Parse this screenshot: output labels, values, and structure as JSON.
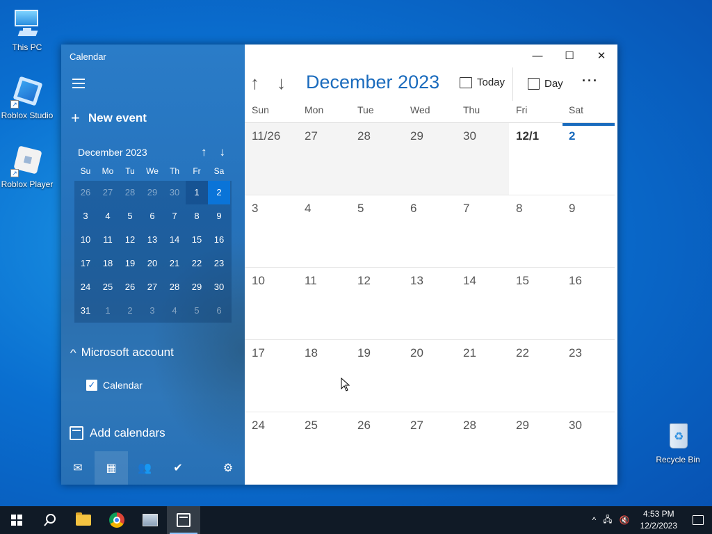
{
  "desktop": {
    "icons": [
      {
        "label": "This PC"
      },
      {
        "label": "Roblox Studio"
      },
      {
        "label": "Roblox Player"
      },
      {
        "label": "Recycle Bin"
      }
    ]
  },
  "window": {
    "app_title": "Calendar",
    "controls": {
      "minimize": "—",
      "maximize": "☐",
      "close": "✕"
    }
  },
  "sidebar": {
    "new_event_label": "New event",
    "mini_calendar": {
      "title": "December 2023",
      "up_arrow": "↑",
      "down_arrow": "↓",
      "weekdays": [
        "Su",
        "Mo",
        "Tu",
        "We",
        "Th",
        "Fr",
        "Sa"
      ],
      "weeks": [
        [
          "26",
          "27",
          "28",
          "29",
          "30",
          "1",
          "2"
        ],
        [
          "3",
          "4",
          "5",
          "6",
          "7",
          "8",
          "9"
        ],
        [
          "10",
          "11",
          "12",
          "13",
          "14",
          "15",
          "16"
        ],
        [
          "17",
          "18",
          "19",
          "20",
          "21",
          "22",
          "23"
        ],
        [
          "24",
          "25",
          "26",
          "27",
          "28",
          "29",
          "30"
        ],
        [
          "31",
          "1",
          "2",
          "3",
          "4",
          "5",
          "6"
        ]
      ],
      "selected_date": "2"
    },
    "account_label": "Microsoft account",
    "calendar_checkbox_label": "Calendar",
    "calendar_checked": true,
    "add_calendars_label": "Add calendars",
    "bottom_nav": [
      "mail-icon",
      "calendar-icon",
      "people-icon",
      "todo-icon",
      "settings-icon"
    ]
  },
  "toolbar": {
    "month_title": "December 2023",
    "up_arrow": "↑",
    "down_arrow": "↓",
    "today_label": "Today",
    "day_label": "Day",
    "more_label": "···"
  },
  "month_view": {
    "weekdays": [
      "Sun",
      "Mon",
      "Tue",
      "Wed",
      "Thu",
      "Fri",
      "Sat"
    ],
    "weeks": [
      [
        "11/26",
        "27",
        "28",
        "29",
        "30",
        "12/1",
        "2"
      ],
      [
        "3",
        "4",
        "5",
        "6",
        "7",
        "8",
        "9"
      ],
      [
        "10",
        "11",
        "12",
        "13",
        "14",
        "15",
        "16"
      ],
      [
        "17",
        "18",
        "19",
        "20",
        "21",
        "22",
        "23"
      ],
      [
        "24",
        "25",
        "26",
        "27",
        "28",
        "29",
        "30"
      ]
    ],
    "today": "2",
    "accent_color": "#1a6bbd"
  },
  "taskbar": {
    "items": [
      "start-icon",
      "search-icon",
      "file-explorer-icon",
      "chrome-icon",
      "this-pc-icon",
      "calendar-app-icon"
    ],
    "clock_time": "4:53 PM",
    "clock_date": "12/2/2023",
    "tray_icons": {
      "chevron": "^",
      "network": "🖧",
      "volume": "🔇"
    }
  }
}
